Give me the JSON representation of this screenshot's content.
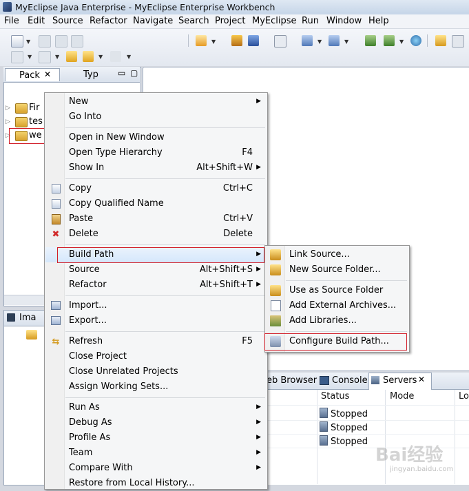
{
  "window": {
    "title": "MyEclipse Java Enterprise - MyEclipse Enterprise Workbench"
  },
  "menubar": [
    "File",
    "Edit",
    "Source",
    "Refactor",
    "Navigate",
    "Search",
    "Project",
    "MyEclipse",
    "Run",
    "Window",
    "Help"
  ],
  "package_explorer": {
    "tabs": [
      "Pack",
      "Typ"
    ],
    "items": [
      "Fir",
      "tes",
      "we"
    ]
  },
  "image_panel": {
    "tab": "Ima"
  },
  "context_menu": {
    "items": [
      {
        "label": "New",
        "shortcut": "",
        "submenu": true
      },
      {
        "label": "Go Into",
        "shortcut": "",
        "submenu": false
      },
      {
        "label": "Open in New Window",
        "shortcut": "",
        "submenu": false
      },
      {
        "label": "Open Type Hierarchy",
        "shortcut": "F4",
        "submenu": false
      },
      {
        "label": "Show In",
        "shortcut": "Alt+Shift+W",
        "submenu": true
      },
      {
        "label": "Copy",
        "shortcut": "Ctrl+C",
        "submenu": false
      },
      {
        "label": "Copy Qualified Name",
        "shortcut": "",
        "submenu": false
      },
      {
        "label": "Paste",
        "shortcut": "Ctrl+V",
        "submenu": false
      },
      {
        "label": "Delete",
        "shortcut": "Delete",
        "submenu": false
      },
      {
        "label": "Build Path",
        "shortcut": "",
        "submenu": true
      },
      {
        "label": "Source",
        "shortcut": "Alt+Shift+S",
        "submenu": true
      },
      {
        "label": "Refactor",
        "shortcut": "Alt+Shift+T",
        "submenu": true
      },
      {
        "label": "Import...",
        "shortcut": "",
        "submenu": false
      },
      {
        "label": "Export...",
        "shortcut": "",
        "submenu": false
      },
      {
        "label": "Refresh",
        "shortcut": "F5",
        "submenu": false
      },
      {
        "label": "Close Project",
        "shortcut": "",
        "submenu": false
      },
      {
        "label": "Close Unrelated Projects",
        "shortcut": "",
        "submenu": false
      },
      {
        "label": "Assign Working Sets...",
        "shortcut": "",
        "submenu": false
      },
      {
        "label": "Run As",
        "shortcut": "",
        "submenu": true
      },
      {
        "label": "Debug As",
        "shortcut": "",
        "submenu": true
      },
      {
        "label": "Profile As",
        "shortcut": "",
        "submenu": true
      },
      {
        "label": "Team",
        "shortcut": "",
        "submenu": true
      },
      {
        "label": "Compare With",
        "shortcut": "",
        "submenu": true
      },
      {
        "label": "Restore from Local History...",
        "shortcut": "",
        "submenu": false
      }
    ]
  },
  "build_path_submenu": {
    "items": [
      "Link Source...",
      "New Source Folder...",
      "Use as Source Folder",
      "Add External Archives...",
      "Add Libraries...",
      "Configure Build Path..."
    ]
  },
  "bottom_tabs": [
    "eb Browser",
    "Console",
    "Servers"
  ],
  "servers_table": {
    "columns": [
      "Status",
      "Mode",
      "Lo"
    ],
    "rows": [
      "Stopped",
      "Stopped",
      "Stopped"
    ]
  },
  "watermark": {
    "main": "Bai经验",
    "sub": "jingyan.baidu.com"
  },
  "colors": {
    "highlight_box": "#d21f2a",
    "menu_bg": "#f5f6f7"
  }
}
